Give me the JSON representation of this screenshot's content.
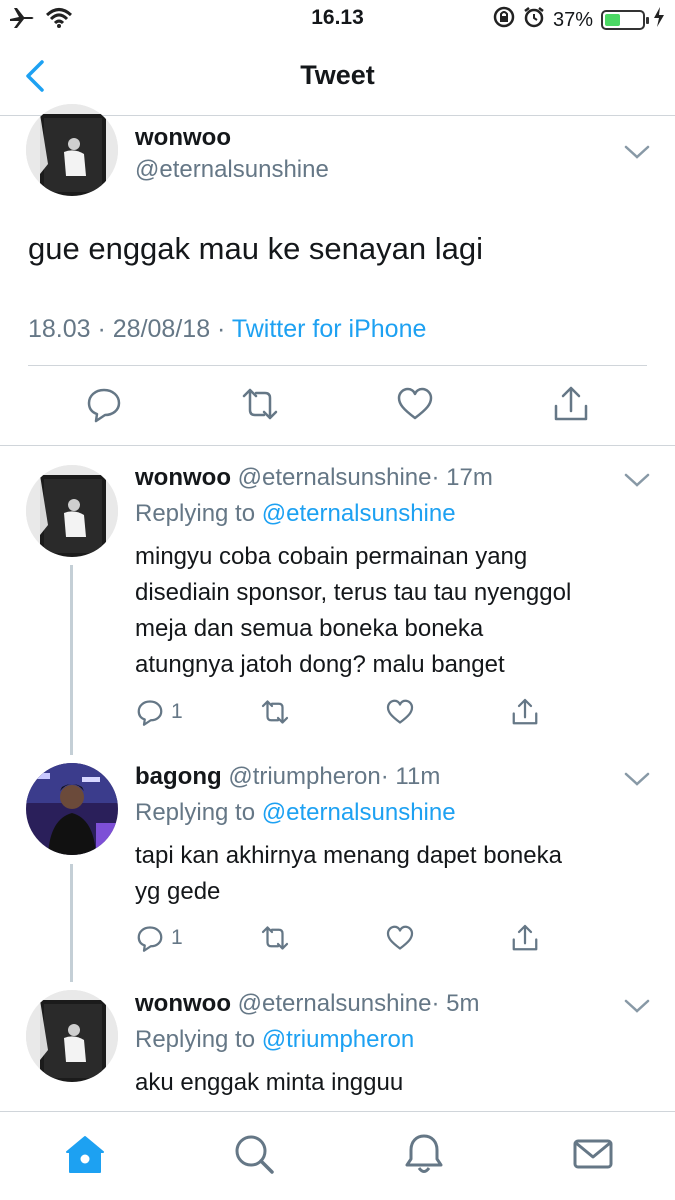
{
  "status_bar": {
    "time": "16.13",
    "battery": "37%",
    "battery_level": 0.37,
    "icons": [
      "airplane-icon",
      "wifi-icon",
      "orientation-lock-icon",
      "alarm-icon",
      "battery-icon",
      "charging-bolt-icon"
    ]
  },
  "nav": {
    "title": "Tweet",
    "back_icon": "chevron-left-icon"
  },
  "main_tweet": {
    "name": "wonwoo",
    "handle": "@eternalsunshine",
    "text": "gue enggak mau ke senayan lagi",
    "time_date": "18.03 · 28/08/18 · ",
    "source": "Twitter for iPhone",
    "actions": [
      "reply-icon",
      "retweet-icon",
      "like-icon",
      "share-icon"
    ]
  },
  "replies": [
    {
      "name": "wonwoo",
      "handle": "@eternalsunshine",
      "time": "· 17m",
      "replying_label": "Replying to ",
      "replying_to": "@eternalsunshine",
      "lines": [
        "mingyu coba cobain permainan yang",
        "disediain sponsor, terus tau tau nyenggol",
        "meja dan semua boneka boneka",
        "atungnya jatoh dong? malu banget"
      ],
      "reply_count": "1"
    },
    {
      "name": "bagong",
      "handle": "@triumpheron",
      "time": "· 11m",
      "replying_label": "Replying to ",
      "replying_to": "@eternalsunshine",
      "lines": [
        "tapi kan akhirnya menang dapet boneka",
        "yg gede"
      ],
      "reply_count": "1"
    },
    {
      "name": "wonwoo",
      "handle": "@eternalsunshine",
      "time": "· 5m",
      "replying_label": "Replying to ",
      "replying_to": "@triumpheron",
      "lines": [
        "aku enggak minta ingguu"
      ]
    }
  ],
  "tab_bar": {
    "tabs": [
      "home-icon",
      "search-icon",
      "notifications-icon",
      "messages-icon"
    ],
    "active_color": "#1da1f2",
    "inactive_color": "#657786"
  },
  "colors": {
    "accent": "#1da1f2",
    "secondary_text": "#657786",
    "thread_line": "#c4cfd6"
  }
}
